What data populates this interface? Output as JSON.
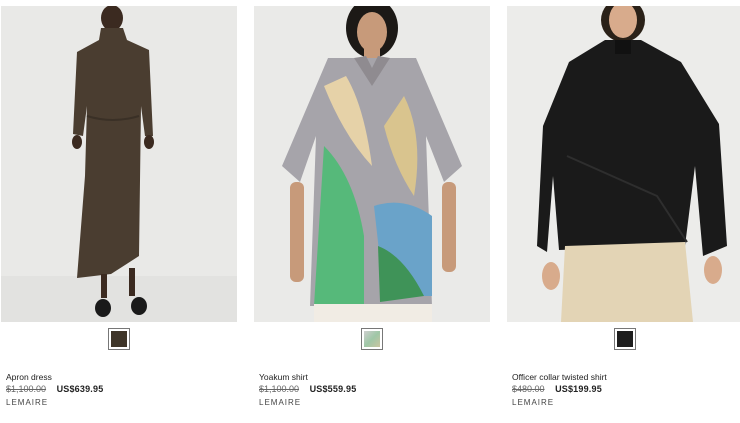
{
  "products": [
    {
      "name": "Apron dress",
      "original_price": "$1,100.00",
      "sale_price": "US$639.95",
      "brand": "LEMAIRE",
      "swatch_color": "#3f3529",
      "photo_icon": "model-in-brown-dress"
    },
    {
      "name": "Yoakum shirt",
      "original_price": "$1,100.00",
      "sale_price": "US$559.95",
      "brand": "LEMAIRE",
      "swatch_color": "#b9c0b4",
      "photo_icon": "model-in-printed-shirt"
    },
    {
      "name": "Officer collar twisted shirt",
      "original_price": "$480.00",
      "sale_price": "US$199.95",
      "brand": "LEMAIRE",
      "swatch_color": "#1d1d1d",
      "photo_icon": "model-in-black-shirt"
    }
  ]
}
